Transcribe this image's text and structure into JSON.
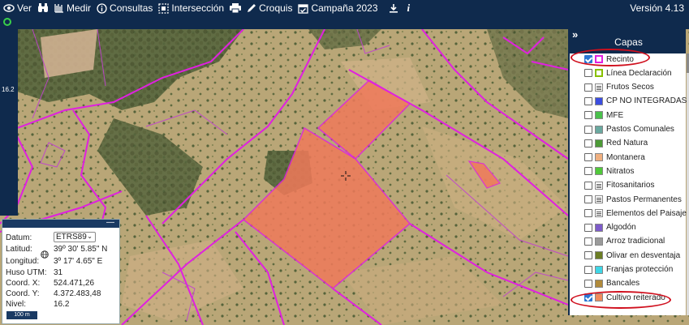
{
  "toolbar": {
    "ver": "Ver",
    "medir": "Medir",
    "consultas": "Consultas",
    "interseccion": "Intersección",
    "croquis": "Croquis",
    "campana": "Campaña 2023",
    "version": "Versión 4.13"
  },
  "icons": [
    "eye-icon",
    "binoculars-icon",
    "ruler-icon",
    "info-icon",
    "selection-icon",
    "print-icon",
    "pencil-icon",
    "calendar-check-icon",
    "download-icon",
    "info-italic-icon",
    "crosshair-icon",
    "globe-icon"
  ],
  "zoom": {
    "level": "16.2"
  },
  "coords": {
    "datum_label": "Datum:",
    "datum_value": "ETRS89",
    "lat_label": "Latitud:",
    "lat_value": "39º 30' 5.85\" N",
    "lon_label": "Longitud:",
    "lon_value": "3º 17' 4.65\" E",
    "huso_label": "Huso UTM:",
    "huso_value": "31",
    "x_label": "Coord. X:",
    "x_value": "524.471,26",
    "y_label": "Coord. Y:",
    "y_value": "4.372.483,48",
    "nivel_label": "Nivel:",
    "nivel_value": "16.2",
    "scale": "100 m",
    "minimize": "—"
  },
  "layers": {
    "toggle": "»",
    "title": "Capas",
    "items": [
      {
        "label": "Recinto",
        "checked": true,
        "swatch": "#ffffff",
        "border": "#e020e0"
      },
      {
        "label": "Línea Declaración",
        "checked": false,
        "swatch": "#ffffff",
        "border": "#88c000"
      },
      {
        "label": "Frutos Secos",
        "checked": false,
        "swatch": "lines"
      },
      {
        "label": "CP NO INTEGRADAS",
        "checked": false,
        "swatch": "#3b4de0"
      },
      {
        "label": "MFE",
        "checked": false,
        "swatch": "#49c04b"
      },
      {
        "label": "Pastos Comunales",
        "checked": false,
        "swatch": "#6aa9a0"
      },
      {
        "label": "Red Natura",
        "checked": false,
        "swatch": "#4c9a36"
      },
      {
        "label": "Montanera",
        "checked": false,
        "swatch": "#f0b080"
      },
      {
        "label": "Nitratos",
        "checked": false,
        "swatch": "#50c83a"
      },
      {
        "label": "Fitosanitarios",
        "checked": false,
        "swatch": "lines"
      },
      {
        "label": "Pastos Permanentes",
        "checked": false,
        "swatch": "lines"
      },
      {
        "label": "Elementos del Paisaje",
        "checked": false,
        "swatch": "lines"
      },
      {
        "label": "Algodón",
        "checked": false,
        "swatch": "#7d5bc9"
      },
      {
        "label": "Arroz tradicional",
        "checked": false,
        "swatch": "#9a9a9a"
      },
      {
        "label": "Olivar en desventaja",
        "checked": false,
        "swatch": "#6b7d24"
      },
      {
        "label": "Franjas protección",
        "checked": false,
        "swatch": "#3fd6e6"
      },
      {
        "label": "Bancales",
        "checked": false,
        "swatch": "#b08a3a"
      },
      {
        "label": "Cultivo reiterado",
        "checked": true,
        "swatch": "#f08a5c"
      }
    ]
  },
  "colors": {
    "toolbar_bg": "#0f2a4d",
    "parcel_outline": "#e020e0",
    "highlight_fill": "#f07a5a",
    "annotation_red": "#d0101e"
  }
}
